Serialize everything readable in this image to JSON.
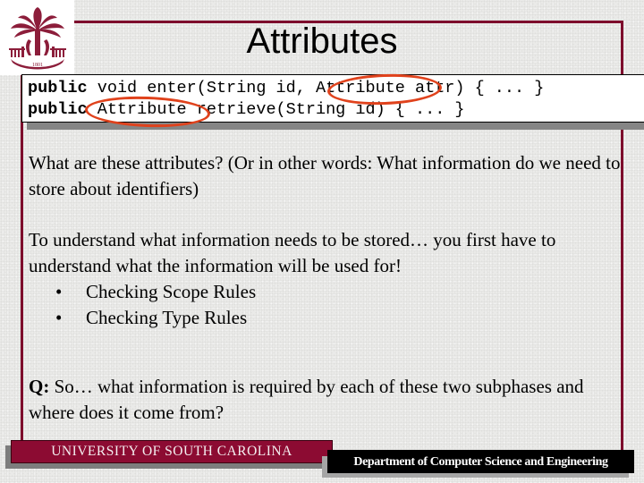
{
  "slide": {
    "title": "Attributes",
    "logo_icon": "university-palmetto-logo-icon",
    "logo_year": "1801",
    "code": {
      "line1_keyword": "public",
      "line1_rest": " void enter(String id, Attribute attr) { ... }",
      "line2_keyword": "public",
      "line2_rest": " Attribute retrieve(String id) { ... }"
    },
    "paragraph1": "What are these attributes? (Or in other words: What information do we need to store about identifiers)",
    "paragraph2": "To understand what information needs to be stored… you first have to understand what the information will be used for!",
    "bullets": [
      {
        "marker": "•",
        "text": "Checking Scope Rules"
      },
      {
        "marker": "•",
        "text": "Checking Type Rules"
      }
    ],
    "question_label": "Q:",
    "question_text": " So… what information is required by each of these two subphases and where does it come from?",
    "footer_left": "UNIVERSITY OF SOUTH CAROLINA",
    "footer_right": "Department of Computer Science and Engineering"
  },
  "colors": {
    "maroon": "#7d0a2c",
    "highlight_circle": "#e0421c",
    "footer_bar_left": "#8c0b32",
    "footer_bar_right": "#000000"
  }
}
